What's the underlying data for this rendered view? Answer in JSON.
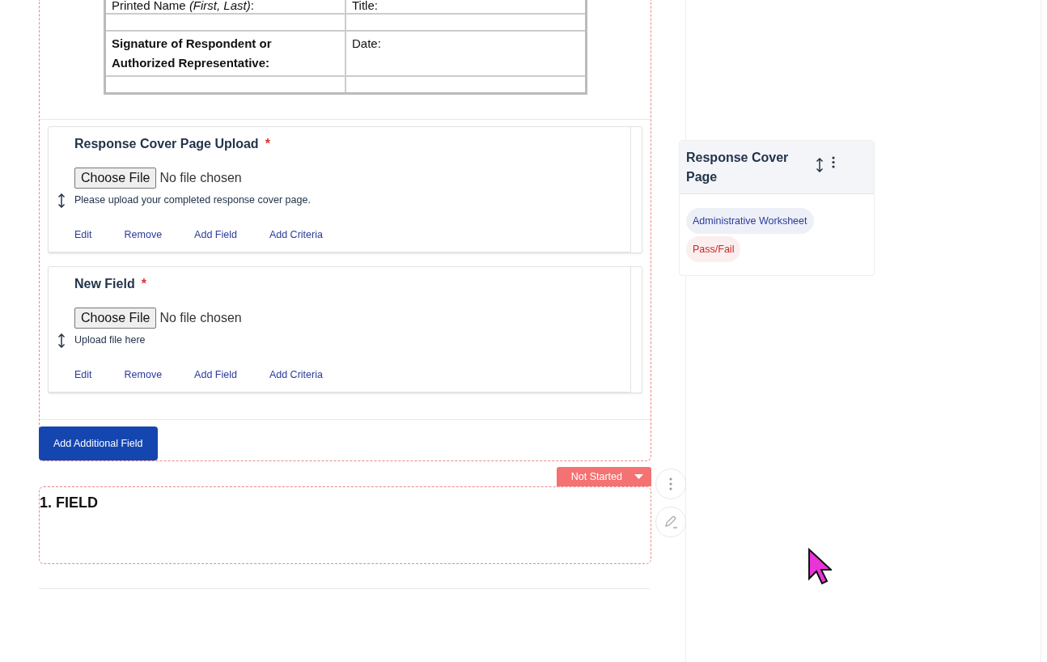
{
  "signature_table": {
    "rows": [
      {
        "kind": "text",
        "cells": [
          {
            "text": "Printed Name *(First, Last)*:",
            "bold": false
          },
          {
            "text": "Title:",
            "bold": false
          }
        ]
      },
      {
        "kind": "blank"
      },
      {
        "kind": "text",
        "cells": [
          {
            "text": "Signature of Respondent or Authorized Representative:",
            "bold": true
          },
          {
            "text": "Date:",
            "bold": false
          }
        ]
      },
      {
        "kind": "blank"
      }
    ]
  },
  "fields": [
    {
      "title": "Response Cover Page Upload",
      "required_mark": "*",
      "file_button": "Choose File",
      "file_status": "No file chosen",
      "hint": "Please upload your completed response cover page.",
      "actions": [
        "Edit",
        "Remove",
        "Add Field",
        "Add Criteria"
      ]
    },
    {
      "title": "New Field",
      "required_mark": "*",
      "file_button": "Choose File",
      "file_status": "No file chosen",
      "hint": "Upload file here",
      "actions": [
        "Edit",
        "Remove",
        "Add Field",
        "Add Criteria"
      ]
    }
  ],
  "add_button": "Add Additional Field",
  "section": {
    "title": "1. FIELD",
    "status": "Not Started"
  },
  "side_card": {
    "title": "Response Cover Page",
    "tags": [
      {
        "label": "Administrative Worksheet",
        "color": "#2a3a9c"
      },
      {
        "label": "Pass/Fail",
        "color": "#c62828"
      }
    ]
  }
}
